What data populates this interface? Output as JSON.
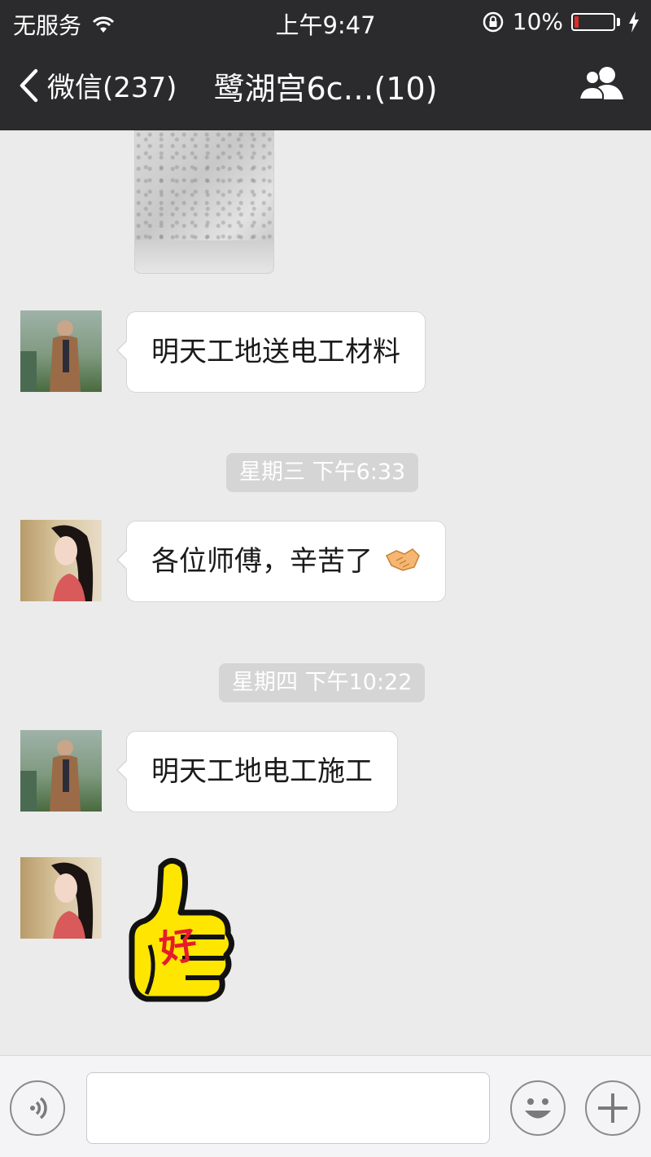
{
  "status_bar": {
    "carrier": "无服务",
    "time": "上午9:47",
    "battery_percent": "10%",
    "battery_level": 0.1
  },
  "nav": {
    "back_label": "微信(237)",
    "title": "鹭湖宫6c…(10)"
  },
  "messages": [
    {
      "type": "image",
      "sender": "unknown"
    },
    {
      "type": "text",
      "sender": "man",
      "text": "明天工地送电工材料"
    },
    {
      "type": "time",
      "text": "星期三 下午6:33"
    },
    {
      "type": "text",
      "sender": "woman",
      "text": "各位师傅，辛苦了",
      "emoji": "handshake-icon"
    },
    {
      "type": "time",
      "text": "星期四 下午10:22"
    },
    {
      "type": "text",
      "sender": "man",
      "text": "明天工地电工施工"
    },
    {
      "type": "sticker",
      "sender": "woman",
      "sticker_text": "好",
      "sticker": "thumbs-up-sticker"
    }
  ],
  "input_bar": {
    "voice_icon": "voice-icon",
    "emoji_icon": "smiley-icon",
    "more_icon": "plus-icon",
    "input_value": ""
  },
  "colors": {
    "header_bg": "#2b2b2d",
    "chat_bg": "#ebebeb",
    "bubble_bg": "#ffffff",
    "battery_low": "#e02b2b",
    "sticker_yellow": "#ffe600"
  }
}
